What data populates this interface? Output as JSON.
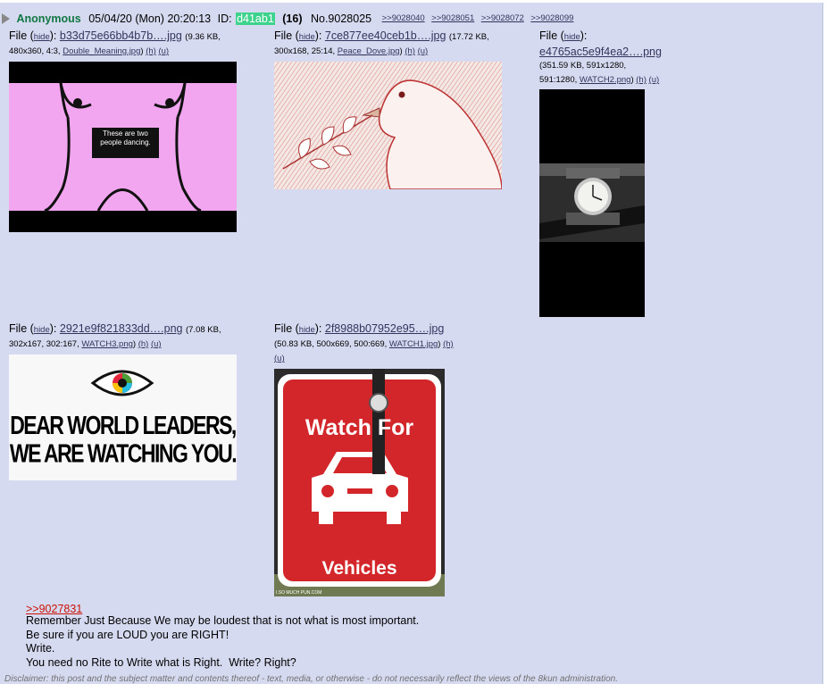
{
  "post": {
    "name": "Anonymous",
    "date": "05/04/20 (Mon) 20:20:13",
    "id_label": "ID:",
    "id": "d41ab1",
    "count": "(16)",
    "number": "No.9028025",
    "backlinks": [
      ">>9028040",
      ">>9028051",
      ">>9028072",
      ">>9028099"
    ]
  },
  "files": [
    {
      "prefix": "File (",
      "hide": "hide",
      "colon": "):",
      "filename": "b33d75e66bb4b7b….jpg",
      "meta_open": "(9.36 KB,",
      "meta_rest": "480x360, 4:3,",
      "original": "Double_Meaning.jpg",
      "h": "(h)",
      "u": "(u)",
      "image_text": "These are two people dancing."
    },
    {
      "prefix": "File (",
      "hide": "hide",
      "colon": "):",
      "filename": "7ce877ee40ceb1b….jpg",
      "meta_open": "(17.72 KB,",
      "meta_rest": "300x168, 25:14,",
      "original": "Peace_Dove.jpg",
      "h": "(h)",
      "u": "(u)"
    },
    {
      "prefix": "File (",
      "hide": "hide",
      "colon": "):",
      "filename": "e4765ac5e9f4ea2….png",
      "meta_open": "(351.59 KB, 591x1280,",
      "meta_rest": "591:1280,",
      "original": "WATCH2.png",
      "h": "(h)",
      "u": "(u)"
    },
    {
      "prefix": "File (",
      "hide": "hide",
      "colon": "):",
      "filename": "2921e9f821833dd….png",
      "meta_open": "(7.08 KB,",
      "meta_rest": "302x167, 302:167,",
      "original": "WATCH3.png",
      "h": "(h)",
      "u": "(u)",
      "image_line1": "DEAR WORLD LEADERS,",
      "image_line2": "WE ARE WATCHING YOU."
    },
    {
      "prefix": "File (",
      "hide": "hide",
      "colon": "):",
      "filename": "2f8988b07952e95….jpg",
      "meta_open": "(50.83 KB, 500x669, 500:669,",
      "original": "WATCH1.jpg",
      "h": "(h)",
      "u": "(u)",
      "sign_line1": "Watch For",
      "sign_line2": "Vehicles",
      "watermark": "I.SO MUCH PUN.COM"
    }
  ],
  "body": {
    "reference": ">>9027831",
    "lines": [
      "Remember Just Because We may be loudest that is not what is most important.",
      "Be sure if you are LOUD you are RIGHT!",
      "Write.",
      "You need no Rite to Write what is Right.  Write? Right?"
    ]
  },
  "disclaimer": "Disclaimer: this post and the subject matter and contents thereof - text, media, or otherwise - do not necessarily reflect the views of the 8kun administration."
}
